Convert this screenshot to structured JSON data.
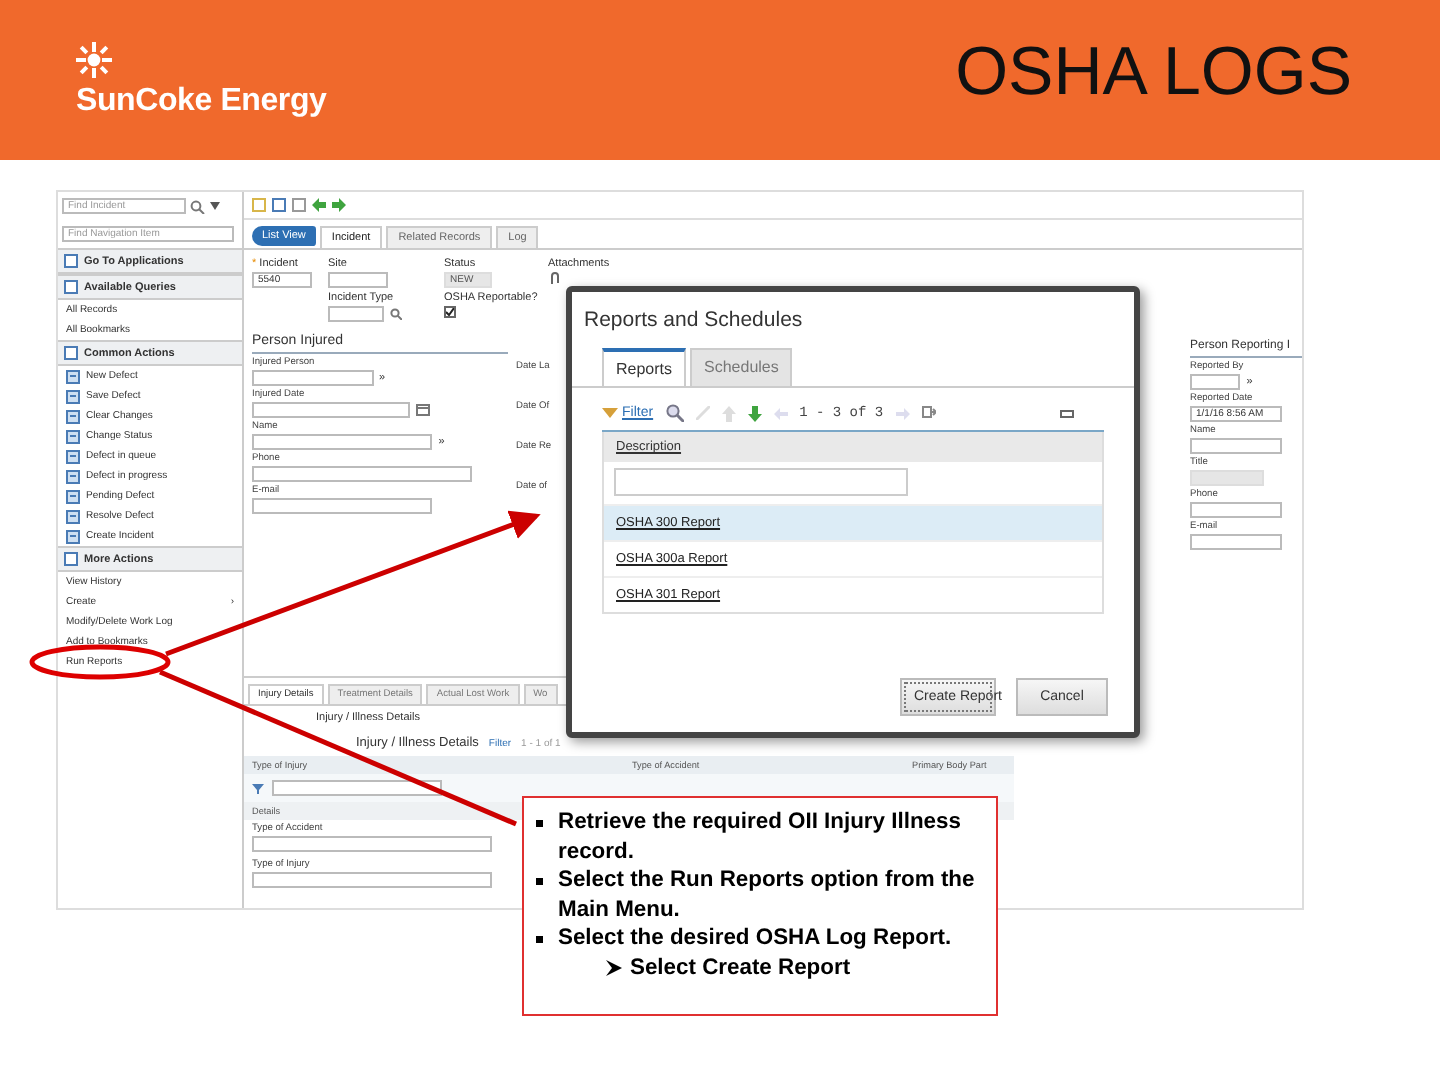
{
  "header": {
    "brand": "SunCoke Energy",
    "title": "OSHA LOGS"
  },
  "app": {
    "search": {
      "placeholder": "Find Incident"
    },
    "nav_search": {
      "placeholder": "Find Navigation Item"
    },
    "sidebar": [
      {
        "kind": "header",
        "label": "Go To Applications"
      },
      {
        "kind": "header",
        "label": "Available Queries"
      },
      {
        "kind": "link",
        "label": "All Records"
      },
      {
        "kind": "link",
        "label": "All Bookmarks"
      },
      {
        "kind": "header",
        "label": "Common Actions"
      },
      {
        "kind": "action",
        "label": "New Defect"
      },
      {
        "kind": "action",
        "label": "Save Defect"
      },
      {
        "kind": "action",
        "label": "Clear Changes"
      },
      {
        "kind": "action",
        "label": "Change Status"
      },
      {
        "kind": "action",
        "label": "Defect in queue"
      },
      {
        "kind": "action",
        "label": "Defect in progress"
      },
      {
        "kind": "action",
        "label": "Pending Defect"
      },
      {
        "kind": "action",
        "label": "Resolve Defect"
      },
      {
        "kind": "action",
        "label": "Create Incident"
      },
      {
        "kind": "header",
        "label": "More Actions"
      },
      {
        "kind": "link",
        "label": "View History"
      },
      {
        "kind": "submenu",
        "label": "Create",
        "marker": "›"
      },
      {
        "kind": "link",
        "label": "Modify/Delete Work Log"
      },
      {
        "kind": "link",
        "label": "Add to Bookmarks"
      },
      {
        "kind": "link",
        "label": "Run Reports"
      }
    ],
    "tabs": [
      {
        "label": "List View",
        "kind": "back",
        "selected": false
      },
      {
        "label": "Incident",
        "kind": "tab",
        "selected": true
      },
      {
        "label": "Related Records",
        "kind": "tab",
        "selected": false
      },
      {
        "label": "Log",
        "kind": "tab",
        "selected": false
      }
    ],
    "top_fields": [
      {
        "kind": "text",
        "label": "Incident",
        "value": "5540",
        "marker": "*"
      },
      {
        "kind": "text",
        "label": "Site"
      },
      {
        "kind": "readonly",
        "label": "Status",
        "value": "NEW"
      },
      {
        "kind": "attachments",
        "label": "Attachments"
      },
      {
        "kind": "lookup",
        "label": "Incident Type"
      },
      {
        "kind": "checkbox",
        "label": "OSHA Reportable?",
        "checked": true
      }
    ],
    "person_injured": {
      "title": "Person Injured",
      "fields": [
        {
          "kind": "more",
          "label": "Injured Person",
          "marker": "»"
        },
        {
          "kind": "date",
          "label": "Injured Date"
        },
        {
          "kind": "wide-more",
          "label": "Name",
          "marker": "»"
        },
        {
          "kind": "text",
          "label": "Phone"
        },
        {
          "kind": "wide",
          "label": "E-mail"
        }
      ],
      "side_labels": [
        "Date La",
        "Date Of",
        "Date Re",
        "Date of"
      ]
    },
    "person_reporting": {
      "title": "Person Reporting I",
      "fields": [
        {
          "kind": "more",
          "label": "Reported By",
          "marker": "»"
        },
        {
          "kind": "text",
          "label": "Reported Date",
          "value": "1/1/16 8:56 AM"
        },
        {
          "kind": "text",
          "label": "Name"
        },
        {
          "kind": "readonly",
          "label": "Title"
        },
        {
          "kind": "text",
          "label": "Phone"
        },
        {
          "kind": "text",
          "label": "E-mail"
        }
      ]
    },
    "bottom_tabs": [
      {
        "label": "Injury Details",
        "selected": true
      },
      {
        "label": "Treatment Details",
        "selected": false
      },
      {
        "label": "Actual Lost Work",
        "selected": false
      },
      {
        "label": "Wo",
        "selected": false
      }
    ],
    "section_title": "Injury / Illness Details",
    "table": {
      "title": "Injury / Illness Details",
      "filter": "Filter",
      "paging": "1 - 1 of 1",
      "columns": [
        "Type of Injury",
        "Type of Accident",
        "Primary Body Part"
      ],
      "details_title": "Details",
      "detail_fields": [
        "Type of Accident",
        "Type of Injury"
      ]
    }
  },
  "dialog": {
    "title": "Reports and Schedules",
    "tabs": [
      {
        "label": "Reports",
        "selected": true
      },
      {
        "label": "Schedules",
        "selected": false
      }
    ],
    "filter": "Filter",
    "paging": "1 - 3 of 3",
    "column": "Description",
    "rows": [
      {
        "label": "OSHA 300 Report",
        "selected": true
      },
      {
        "label": "OSHA 300a Report",
        "selected": false
      },
      {
        "label": "OSHA 301 Report",
        "selected": false
      }
    ],
    "buttons": [
      {
        "label": "Create Report",
        "kind": "primary"
      },
      {
        "label": "Cancel",
        "kind": "secondary"
      }
    ]
  },
  "callout": {
    "items": [
      {
        "text": "Retrieve the required OII Injury Illness record."
      },
      {
        "text": "Select the Run Reports option from the Main Menu."
      },
      {
        "text": "Select the desired OSHA Log Report.",
        "children": [
          {
            "text": "Select Create Report"
          }
        ]
      }
    ]
  }
}
